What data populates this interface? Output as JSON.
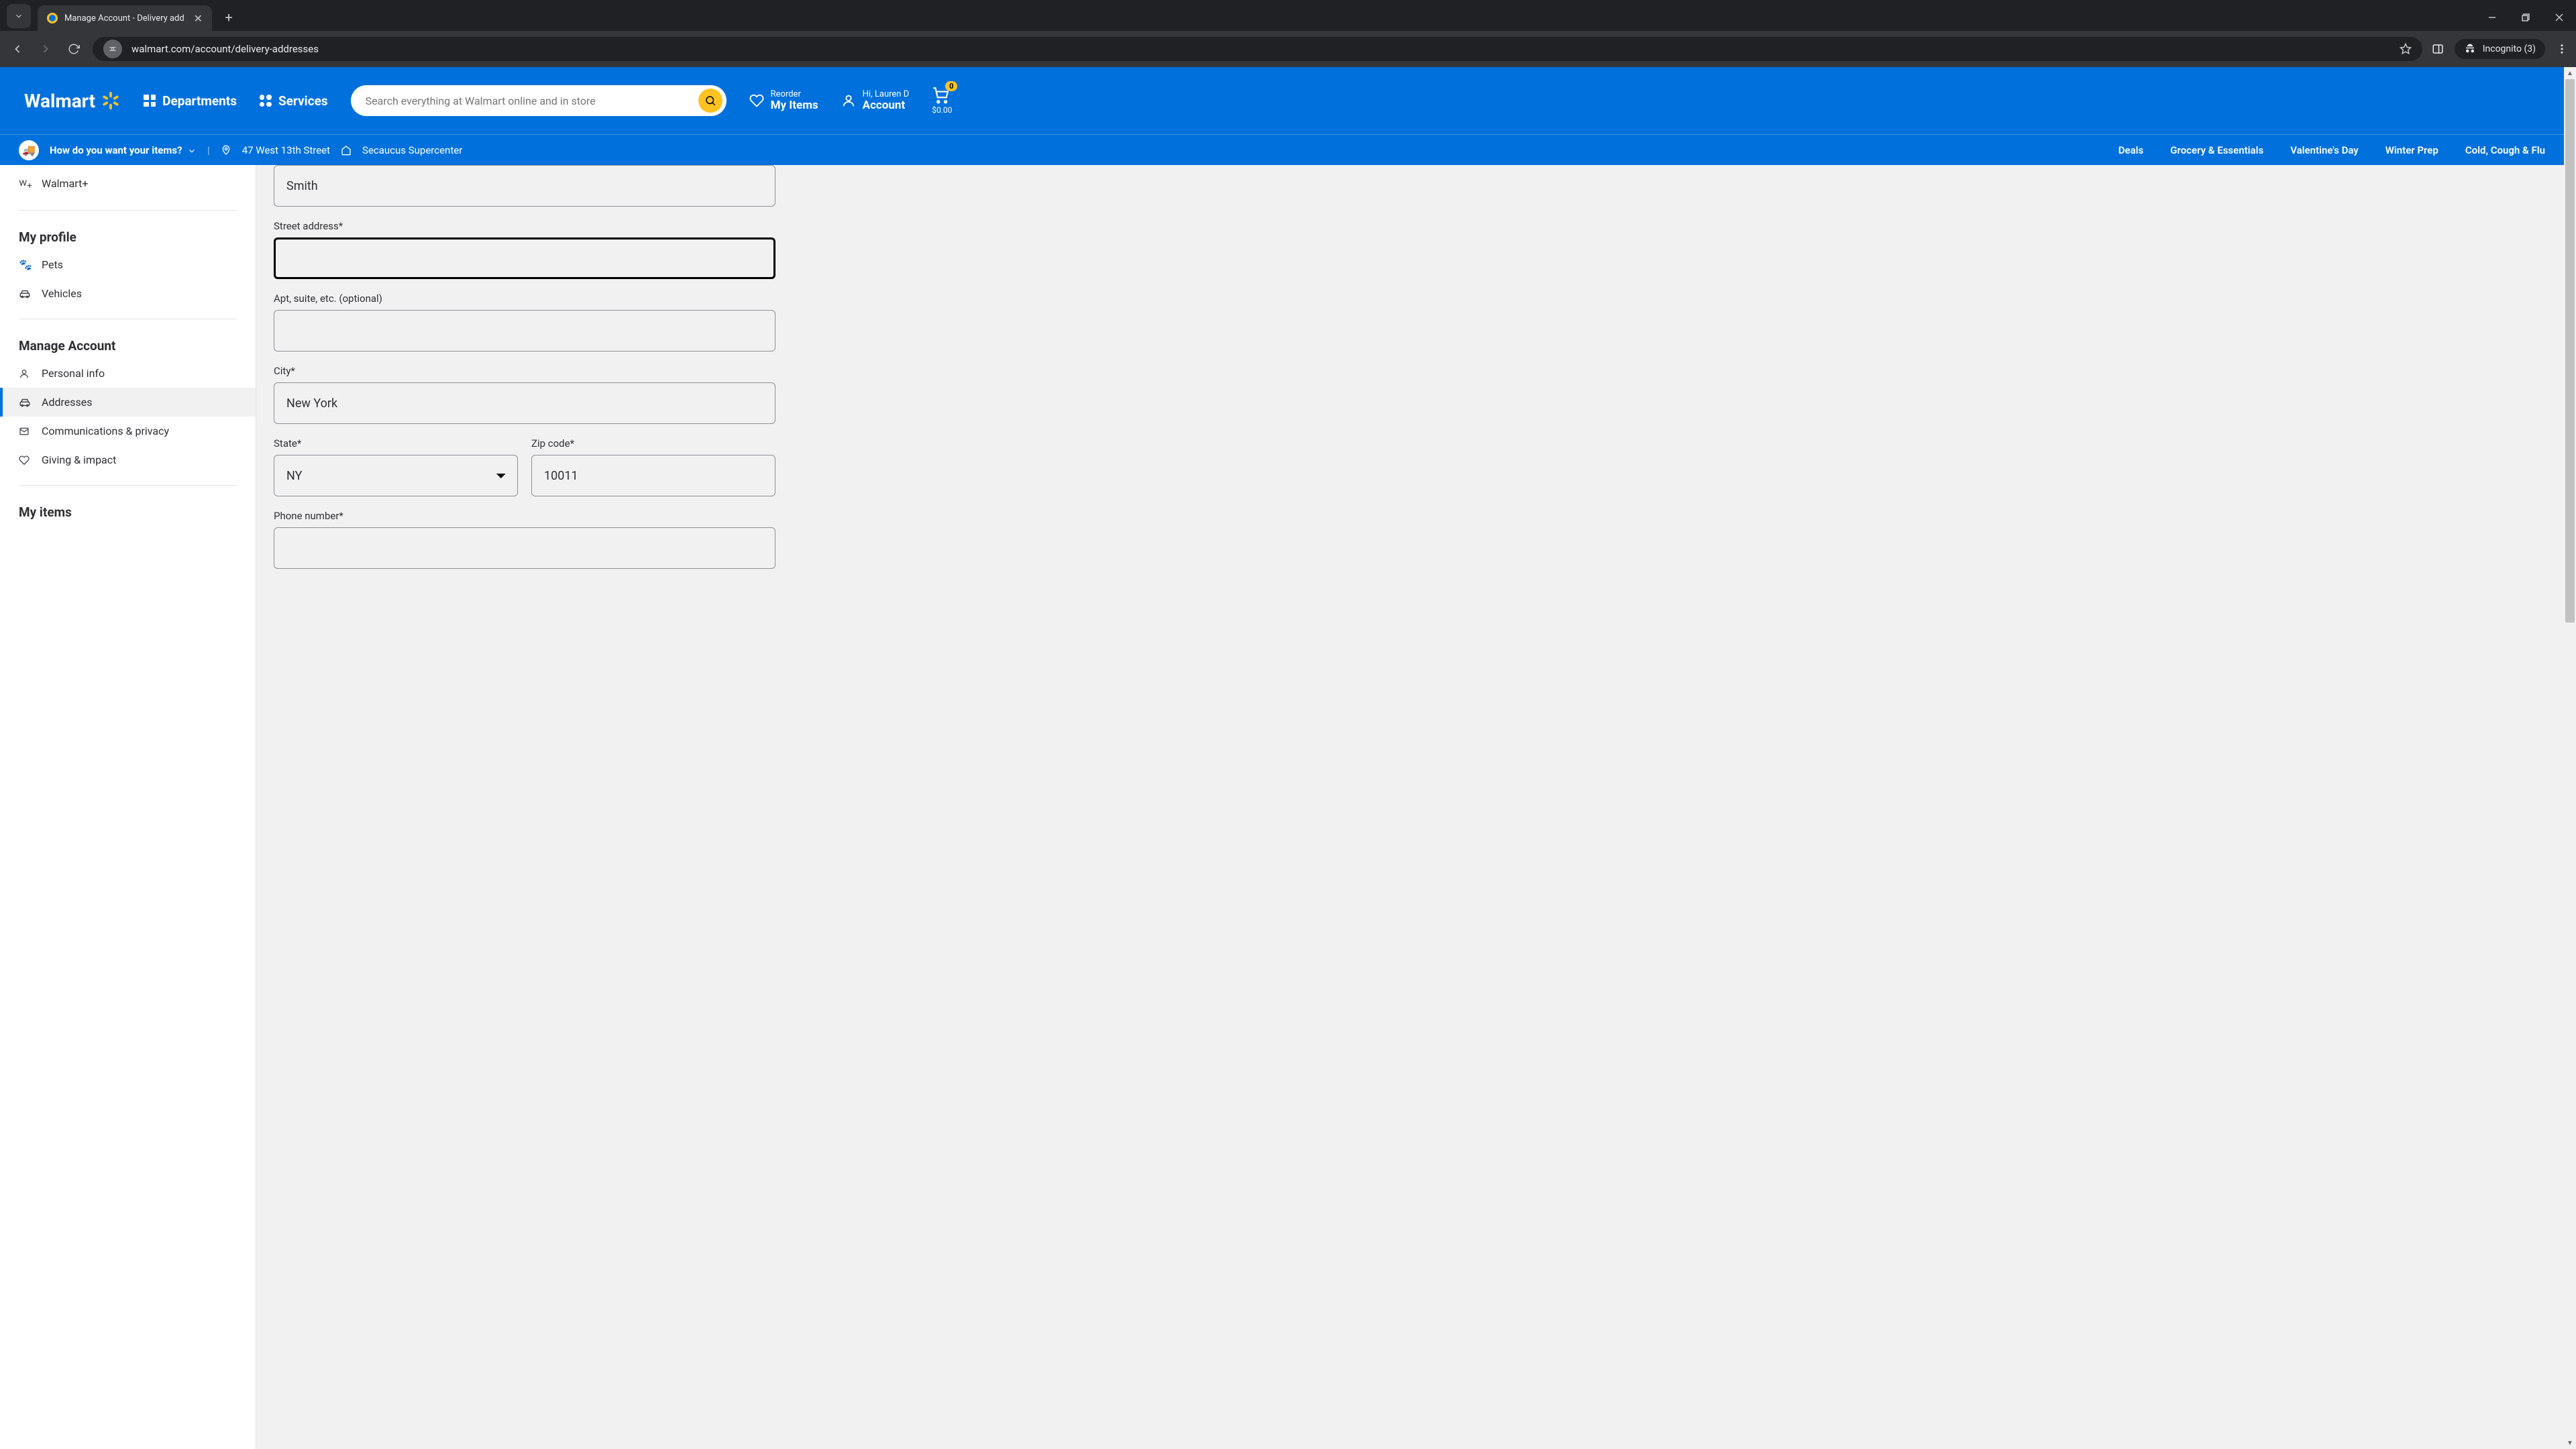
{
  "browser": {
    "tab_title": "Manage Account - Delivery add",
    "url": "walmart.com/account/delivery-addresses",
    "incognito_label": "Incognito (3)"
  },
  "header": {
    "logo_text": "Walmart",
    "departments": "Departments",
    "services": "Services",
    "search_placeholder": "Search everything at Walmart online and in store",
    "reorder_l1": "Reorder",
    "reorder_l2": "My Items",
    "account_l1": "Hi, Lauren D",
    "account_l2": "Account",
    "cart_count": "0",
    "cart_amount": "$0.00"
  },
  "subheader": {
    "intent_label": "How do you want your items?",
    "address": "47 West 13th Street",
    "store": "Secaucus Supercenter",
    "links": [
      "Deals",
      "Grocery & Essentials",
      "Valentine's Day",
      "Winter Prep",
      "Cold, Cough & Flu"
    ]
  },
  "sidebar": {
    "walmart_plus": "Walmart+",
    "section_profile": "My profile",
    "pets": "Pets",
    "vehicles": "Vehicles",
    "section_manage": "Manage Account",
    "personal_info": "Personal info",
    "addresses": "Addresses",
    "communications": "Communications & privacy",
    "giving": "Giving & impact",
    "section_items": "My items"
  },
  "form": {
    "last_name_value": "Smith",
    "street_label": "Street address*",
    "street_value": "",
    "apt_label": "Apt, suite, etc. (optional)",
    "apt_value": "",
    "city_label": "City*",
    "city_value": "New York",
    "state_label": "State*",
    "state_value": "NY",
    "zip_label": "Zip code*",
    "zip_value": "10011",
    "phone_label": "Phone number*",
    "phone_value": ""
  }
}
